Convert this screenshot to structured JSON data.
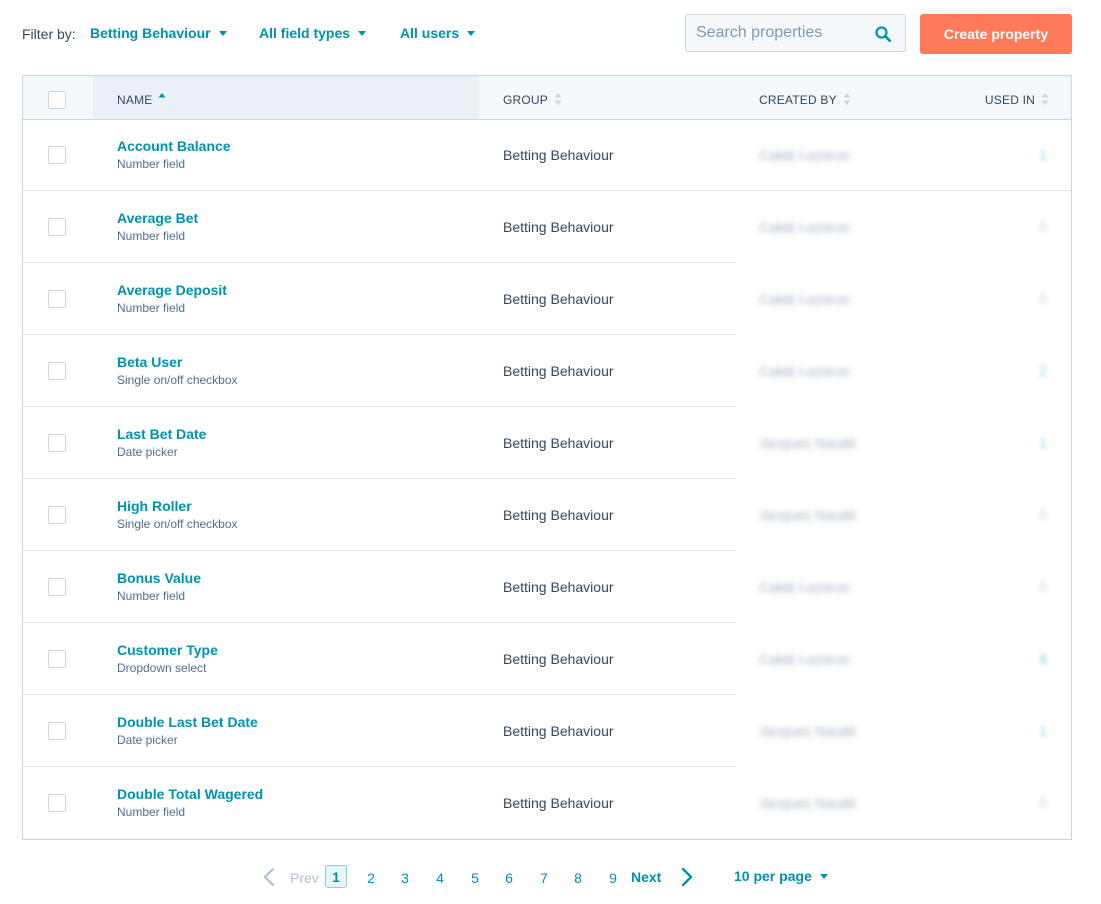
{
  "filters": {
    "label": "Filter by:",
    "group": "Betting Behaviour",
    "field_types": "All field types",
    "users": "All users"
  },
  "search": {
    "placeholder": "Search properties"
  },
  "create_button": "Create property",
  "table": {
    "columns": {
      "name": "NAME",
      "group": "GROUP",
      "created_by": "CREATED BY",
      "used_in": "USED IN"
    },
    "rows": [
      {
        "name": "Account Balance",
        "type": "Number field",
        "group": "Betting Behaviour",
        "created_by": "Caleb Lazarus",
        "used_in": "1",
        "used_color": "#7fd1de"
      },
      {
        "name": "Average Bet",
        "type": "Number field",
        "group": "Betting Behaviour",
        "created_by": "Caleb Lazarus",
        "used_in": "0",
        "used_color": "#cbd6e2"
      },
      {
        "name": "Average Deposit",
        "type": "Number field",
        "group": "Betting Behaviour",
        "created_by": "Caleb Lazarus",
        "used_in": "0",
        "used_color": "#cbd6e2"
      },
      {
        "name": "Beta User",
        "type": "Single on/off checkbox",
        "group": "Betting Behaviour",
        "created_by": "Caleb Lazarus",
        "used_in": "2",
        "used_color": "#7fd1de"
      },
      {
        "name": "Last Bet Date",
        "type": "Date picker",
        "group": "Betting Behaviour",
        "created_by": "Jacques Naudé",
        "used_in": "1",
        "used_color": "#7fd1de"
      },
      {
        "name": "High Roller",
        "type": "Single on/off checkbox",
        "group": "Betting Behaviour",
        "created_by": "Jacques Naudé",
        "used_in": "0",
        "used_color": "#cbd6e2"
      },
      {
        "name": "Bonus Value",
        "type": "Number field",
        "group": "Betting Behaviour",
        "created_by": "Caleb Lazarus",
        "used_in": "0",
        "used_color": "#cbd6e2"
      },
      {
        "name": "Customer Type",
        "type": "Dropdown select",
        "group": "Betting Behaviour",
        "created_by": "Caleb Lazarus",
        "used_in": "6",
        "used_color": "#7fd1de"
      },
      {
        "name": "Double Last Bet Date",
        "type": "Date picker",
        "group": "Betting Behaviour",
        "created_by": "Jacques Naudé",
        "used_in": "1",
        "used_color": "#7fd1de"
      },
      {
        "name": "Double Total Wagered",
        "type": "Number field",
        "group": "Betting Behaviour",
        "created_by": "Jacques Naudé",
        "used_in": "0",
        "used_color": "#cbd6e2"
      }
    ]
  },
  "pagination": {
    "prev": "Prev",
    "next": "Next",
    "pages": [
      "1",
      "2",
      "3",
      "4",
      "5",
      "6",
      "7",
      "8",
      "9"
    ],
    "current": "1",
    "per_page": "10 per page"
  }
}
